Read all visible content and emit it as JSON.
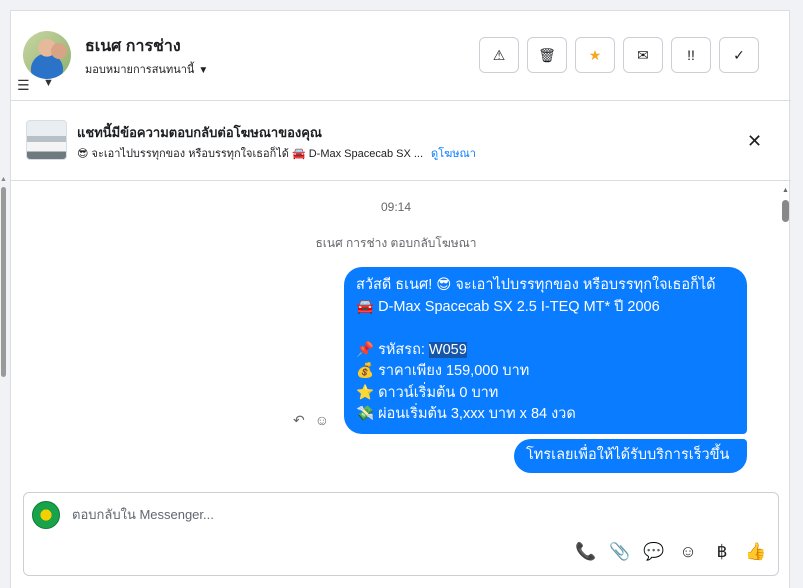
{
  "header": {
    "name": "ธเนศ การช่าง",
    "assignee": "มอบหมายการสนทนานี้",
    "tools": [
      {
        "name": "report-button",
        "glyph": "⚠"
      },
      {
        "name": "delete-button",
        "glyph": "🗑"
      },
      {
        "name": "star-button",
        "glyph": "★"
      },
      {
        "name": "mark-unread-button",
        "glyph": "✉"
      },
      {
        "name": "follow-up-button",
        "glyph": "!!"
      },
      {
        "name": "done-button",
        "glyph": "✓"
      }
    ]
  },
  "ad": {
    "title": "แชทนี้มีข้อความตอบกลับต่อโฆษณาของคุณ",
    "subtitle": "😎 จะเอาไปบรรทุกของ หรือบรรทุกใจเธอก็ได้ 🚘 D-Max Spacecab SX ...",
    "link": "ดูโฆษณา",
    "close": "✕"
  },
  "thread": {
    "time": "09:14",
    "system": "ธเนศ การช่าง ตอบกลับโฆษณา",
    "message_lines": [
      "สวัสดี ธเนศ! 😎 จะเอาไปบรรทุกของ หรือบรรทุกใจเธอก็ได้",
      "🚘 D-Max Spacecab SX 2.5 I-TEQ MT* ปี 2006",
      "",
      "📌 รหัสรถ: ",
      "💰 ราคาเพียง 159,000 บาท",
      "⭐ ดาวน์เริ่มต้น 0 บาท",
      "💸 ผ่อนเริ่มต้น 3,xxx บาท x 84 งวด"
    ],
    "code": "W059",
    "cta": "โทรเลยเพื่อให้ได้รับบริการเร็วขึ้น"
  },
  "composer": {
    "placeholder": "ตอบกลับใน Messenger...",
    "tools": [
      "call-icon",
      "attach-icon",
      "saved-reply-icon",
      "emoji-icon",
      "payment-icon",
      "like-icon"
    ]
  }
}
